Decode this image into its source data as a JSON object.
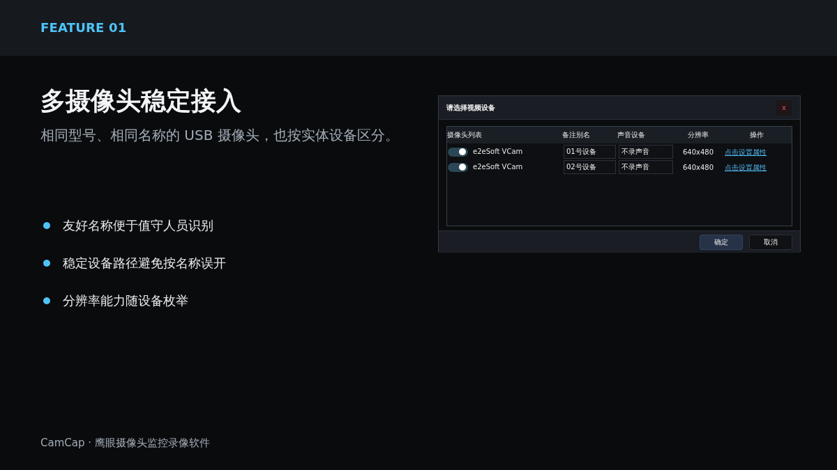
{
  "header": {
    "label": "FEATURE 01"
  },
  "title": "多摄像头稳定接入",
  "subtitle": "相同型号、相同名称的 USB 摄像头，也按实体设备区分。",
  "bullets": [
    "友好名称便于值守人员识别",
    "稳定设备路径避免按名称误开",
    "分辨率能力随设备枚举"
  ],
  "dialog": {
    "title": "请选择视频设备",
    "close": "x",
    "table": {
      "columns": [
        "摄像头列表",
        "备注别名",
        "声音设备",
        "分辨率",
        "操作"
      ],
      "rows": [
        {
          "on": true,
          "camera": "e2eSoft VCam",
          "alias": "01号设备",
          "audio": "不录声音",
          "resolution": "640x480",
          "action": "点击设置属性"
        },
        {
          "on": true,
          "camera": "e2eSoft VCam",
          "alias": "02号设备",
          "audio": "不录声音",
          "resolution": "640x480",
          "action": "点击设置属性"
        }
      ]
    },
    "buttons": [
      {
        "label": "确定",
        "primary": true
      },
      {
        "label": "取消",
        "primary": false
      }
    ]
  },
  "footer": "CamCap · 鹰眼摄像头监控录像软件"
}
